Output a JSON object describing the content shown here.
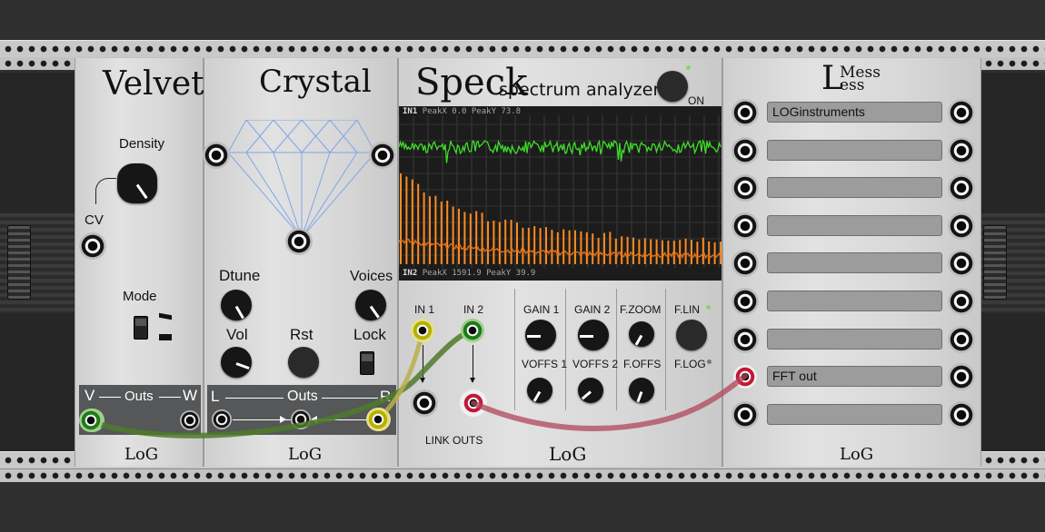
{
  "velvet": {
    "title": "Velvet",
    "density_label": "Density",
    "cv_label": "CV",
    "mode_label": "Mode",
    "outs_v": "V",
    "outs_label": "Outs",
    "outs_w": "W",
    "logo": "LoG"
  },
  "crystal": {
    "title": "Crystal",
    "dtune_label": "Dtune",
    "voices_label": "Voices",
    "vol_label": "Vol",
    "rst_label": "Rst",
    "lock_label": "Lock",
    "outs_l": "L",
    "outs_label": "Outs",
    "outs_r": "R",
    "logo": "LoG"
  },
  "speck": {
    "title": "Speck",
    "subtitle": "spectrum analyzer",
    "on_label": "ON",
    "in1_label": "IN1",
    "in1_peakx": "PeakX   0.0",
    "in1_peaky": "PeakY  73.8",
    "in2_label": "IN2",
    "in2_peakx": "PeakX 1591.9",
    "in2_peaky": "PeakY  39.9",
    "input1_label": "IN 1",
    "input2_label": "IN 2",
    "link_outs_label": "LINK OUTS",
    "gain1_label": "GAIN 1",
    "gain2_label": "GAIN 2",
    "fzoom_label": "F.ZOOM",
    "flin_label": "F.LIN",
    "voffs1_label": "VOFFS 1",
    "voffs2_label": "VOFFS 2",
    "foffs_label": "F.OFFS",
    "flog_label": "F.LOG",
    "logo": "LoG"
  },
  "lessmess": {
    "title_l": "L",
    "title_mess": "Mess",
    "title_ess": "ess",
    "labels": [
      "LOGinstruments",
      "",
      "",
      "",
      "",
      "",
      "",
      "FFT out",
      ""
    ],
    "logo": "LoG"
  },
  "colors": {
    "cable_green": "#4e7a2a",
    "cable_yellow": "#b8b04a",
    "cable_red": "#b0455a",
    "spectrum_green": "#3fdc2a",
    "spectrum_orange": "#ff8a1e"
  }
}
